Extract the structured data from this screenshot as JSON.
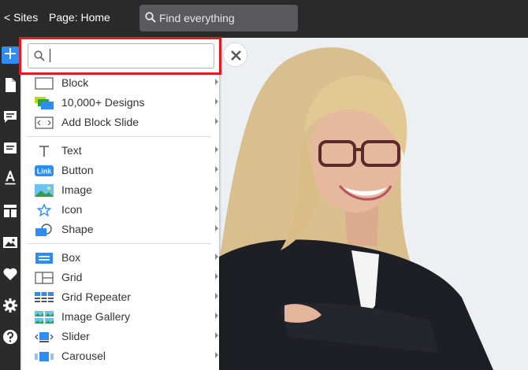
{
  "topbar": {
    "sites_link": "< Sites",
    "page_label": "Page: Home",
    "search_placeholder": "Find everything"
  },
  "search": {
    "value": ""
  },
  "menu": {
    "group1": [
      {
        "label": "Block",
        "icon": "block-icon"
      },
      {
        "label": "10,000+ Designs",
        "icon": "designs-icon"
      },
      {
        "label": "Add Block Slide",
        "icon": "block-slide-icon"
      }
    ],
    "group2": [
      {
        "label": "Text",
        "icon": "text-icon"
      },
      {
        "label": "Button",
        "icon": "button-icon",
        "badge": "Link"
      },
      {
        "label": "Image",
        "icon": "image-icon"
      },
      {
        "label": "Icon",
        "icon": "star-icon"
      },
      {
        "label": "Shape",
        "icon": "shape-icon"
      }
    ],
    "group3": [
      {
        "label": "Box",
        "icon": "box-icon"
      },
      {
        "label": "Grid",
        "icon": "grid-icon"
      },
      {
        "label": "Grid Repeater",
        "icon": "grid-repeater-icon"
      },
      {
        "label": "Image Gallery",
        "icon": "image-gallery-icon"
      },
      {
        "label": "Slider",
        "icon": "slider-icon"
      },
      {
        "label": "Carousel",
        "icon": "carousel-icon"
      }
    ]
  },
  "colors": {
    "accent": "#2f8cf5",
    "highlight": "#e31b23",
    "topbar": "#2a2a2b"
  }
}
